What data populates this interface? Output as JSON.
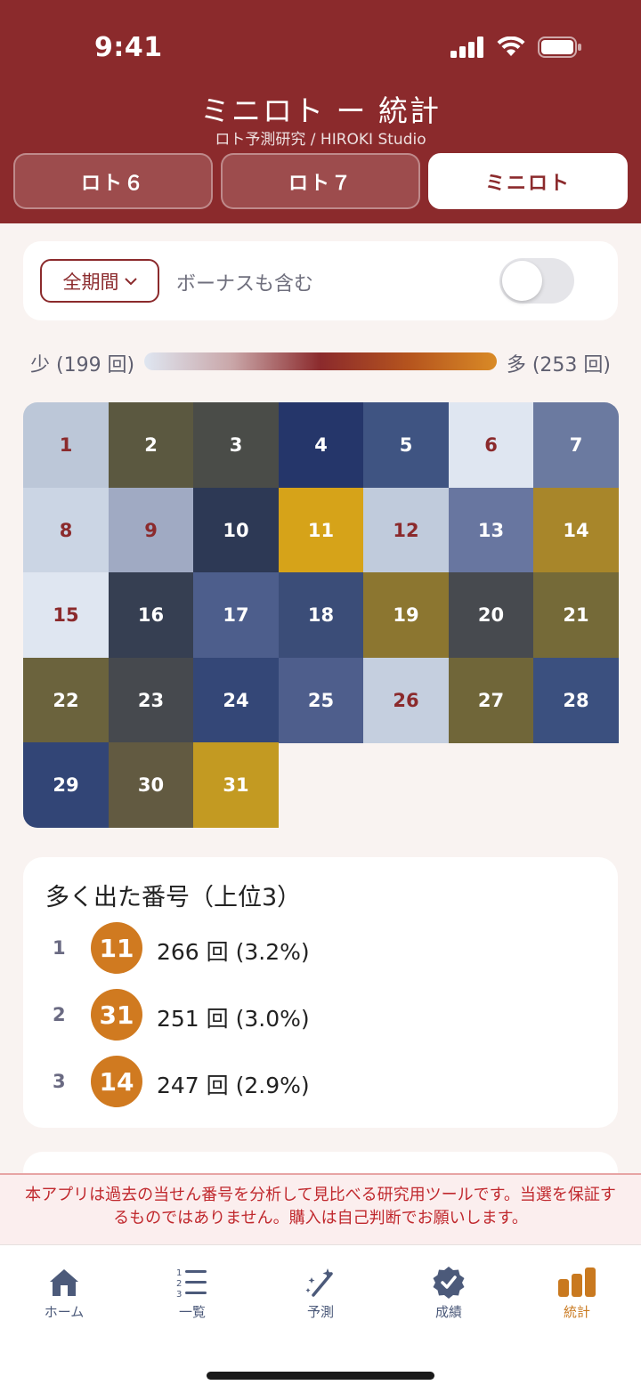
{
  "status": {
    "time": "9:41"
  },
  "header": {
    "title": "ミニロト ー 統計",
    "subtitle": "ロト予測研究 / HIROKI Studio"
  },
  "tabs": [
    {
      "label": "ロト６",
      "active": false
    },
    {
      "label": "ロト７",
      "active": false
    },
    {
      "label": "ミニロト",
      "active": true
    }
  ],
  "filter": {
    "period_label": "全期間",
    "bonus_label": "ボーナスも含む",
    "bonus_enabled": false
  },
  "legend": {
    "min_label": "少 (199 回)",
    "max_label": "多 (253 回)"
  },
  "heatmap": {
    "cells": [
      {
        "n": "1",
        "bg": "#bcc7d8",
        "fg": "#8b2a2c"
      },
      {
        "n": "2",
        "bg": "#5b5840",
        "fg": "#ffffff"
      },
      {
        "n": "3",
        "bg": "#4a4c48",
        "fg": "#ffffff"
      },
      {
        "n": "4",
        "bg": "#25366a",
        "fg": "#ffffff"
      },
      {
        "n": "5",
        "bg": "#3f5482",
        "fg": "#ffffff"
      },
      {
        "n": "6",
        "bg": "#dfe6f1",
        "fg": "#8b2a2c"
      },
      {
        "n": "7",
        "bg": "#6b7aa0",
        "fg": "#ffffff"
      },
      {
        "n": "8",
        "bg": "#cbd5e4",
        "fg": "#8b2a2c"
      },
      {
        "n": "9",
        "bg": "#a0aac3",
        "fg": "#8b2a2c"
      },
      {
        "n": "10",
        "bg": "#2d3955",
        "fg": "#ffffff"
      },
      {
        "n": "11",
        "bg": "#d6a319",
        "fg": "#ffffff"
      },
      {
        "n": "12",
        "bg": "#c0cbdc",
        "fg": "#8b2a2c"
      },
      {
        "n": "13",
        "bg": "#6876a0",
        "fg": "#ffffff"
      },
      {
        "n": "14",
        "bg": "#a8862a",
        "fg": "#ffffff"
      },
      {
        "n": "15",
        "bg": "#dfe6f1",
        "fg": "#8b2a2c"
      },
      {
        "n": "16",
        "bg": "#363f52",
        "fg": "#ffffff"
      },
      {
        "n": "17",
        "bg": "#4d5e8c",
        "fg": "#ffffff"
      },
      {
        "n": "18",
        "bg": "#3b4d78",
        "fg": "#ffffff"
      },
      {
        "n": "19",
        "bg": "#8c7630",
        "fg": "#ffffff"
      },
      {
        "n": "20",
        "bg": "#474a4f",
        "fg": "#ffffff"
      },
      {
        "n": "21",
        "bg": "#756a38",
        "fg": "#ffffff"
      },
      {
        "n": "22",
        "bg": "#6b633d",
        "fg": "#ffffff"
      },
      {
        "n": "23",
        "bg": "#46494e",
        "fg": "#ffffff"
      },
      {
        "n": "24",
        "bg": "#344777",
        "fg": "#ffffff"
      },
      {
        "n": "25",
        "bg": "#4e5e8c",
        "fg": "#ffffff"
      },
      {
        "n": "26",
        "bg": "#c5cfdf",
        "fg": "#8b2a2c"
      },
      {
        "n": "27",
        "bg": "#706639",
        "fg": "#ffffff"
      },
      {
        "n": "28",
        "bg": "#3b507f",
        "fg": "#ffffff"
      },
      {
        "n": "29",
        "bg": "#324576",
        "fg": "#ffffff"
      },
      {
        "n": "30",
        "bg": "#625a41",
        "fg": "#ffffff"
      },
      {
        "n": "31",
        "bg": "#c39a22",
        "fg": "#ffffff"
      }
    ]
  },
  "top_numbers": {
    "title": "多く出た番号（上位3）",
    "items": [
      {
        "rank": "1",
        "number": "11",
        "count": "266 回 (3.2%)"
      },
      {
        "rank": "2",
        "number": "31",
        "count": "251 回 (3.0%)"
      },
      {
        "rank": "3",
        "number": "14",
        "count": "247 回 (2.9%)"
      }
    ]
  },
  "disclaimer": "本アプリは過去の当せん番号を分析して見比べる研究用ツールです。当選を保証するものではありません。購入は自己判断でお願いします。",
  "nav": [
    {
      "label": "ホーム",
      "icon": "home-icon",
      "active": false
    },
    {
      "label": "一覧",
      "icon": "list-icon",
      "active": false
    },
    {
      "label": "予測",
      "icon": "magic-wand-icon",
      "active": false
    },
    {
      "label": "成績",
      "icon": "badge-check-icon",
      "active": false
    },
    {
      "label": "統計",
      "icon": "bar-chart-icon",
      "active": true
    }
  ],
  "colors": {
    "brand": "#8b2a2c",
    "accent": "#d07a20",
    "background": "#f9f3f1"
  }
}
